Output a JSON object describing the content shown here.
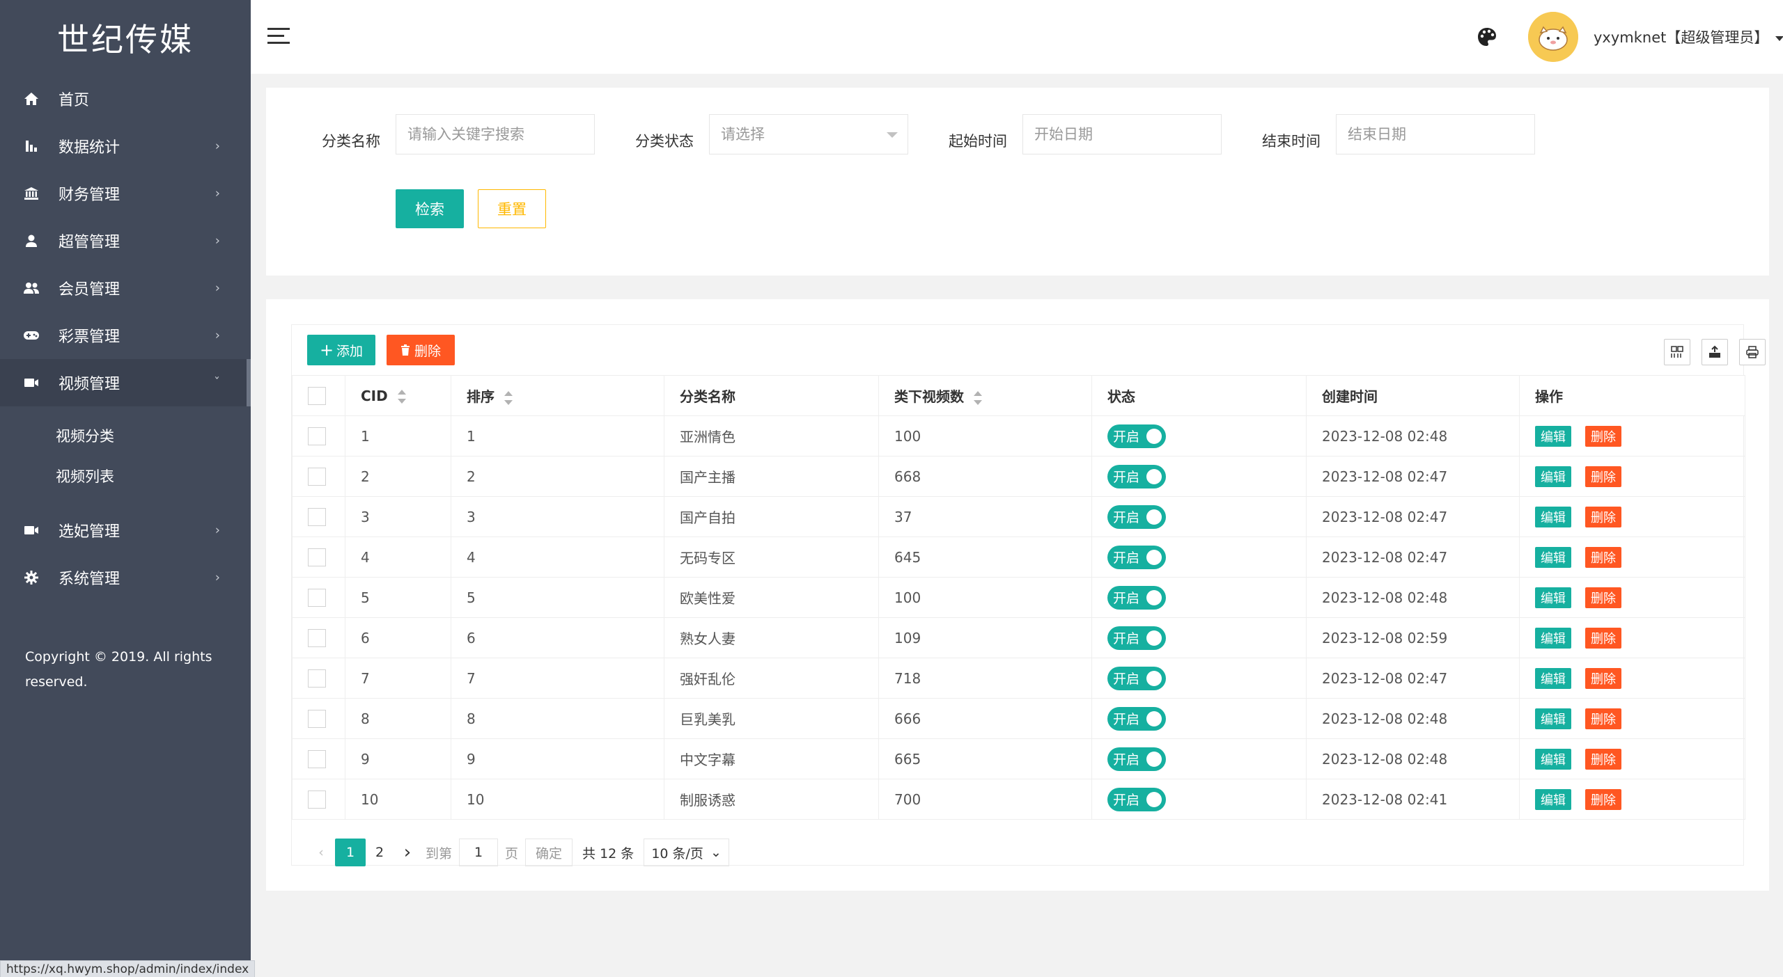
{
  "sidebar": {
    "logo": "世纪传媒",
    "items": [
      {
        "label": "首页",
        "icon": "home-icon"
      },
      {
        "label": "数据统计",
        "icon": "bar-chart-icon"
      },
      {
        "label": "财务管理",
        "icon": "bank-icon"
      },
      {
        "label": "超管管理",
        "icon": "user-icon"
      },
      {
        "label": "会员管理",
        "icon": "users-icon"
      },
      {
        "label": "彩票管理",
        "icon": "gamepad-icon"
      },
      {
        "label": "视频管理",
        "icon": "video-icon"
      },
      {
        "label": "选妃管理",
        "icon": "video-icon"
      },
      {
        "label": "系统管理",
        "icon": "gear-icon"
      }
    ],
    "video_sub": [
      "视频分类",
      "视频列表"
    ],
    "copyright": "Copyright © 2019. All rights reserved."
  },
  "header": {
    "username": "yxymknet【超级管理员】"
  },
  "search": {
    "name_label": "分类名称",
    "name_placeholder": "请输入关键字搜索",
    "status_label": "分类状态",
    "status_value": "请选择",
    "start_label": "起始时间",
    "start_placeholder": "开始日期",
    "end_label": "结束时间",
    "end_placeholder": "结束日期",
    "search_button": "检索",
    "reset_button": "重置"
  },
  "table": {
    "add_button": "添加",
    "delete_button": "删除",
    "columns": [
      "CID",
      "排序",
      "分类名称",
      "类下视频数",
      "状态",
      "创建时间",
      "操作"
    ],
    "switch_label": "开启",
    "edit_label": "编辑",
    "remove_label": "删除",
    "rows": [
      {
        "cid": "1",
        "sort": "1",
        "name": "亚洲情色",
        "count": "100",
        "created": "2023-12-08 02:48"
      },
      {
        "cid": "2",
        "sort": "2",
        "name": "国产主播",
        "count": "668",
        "created": "2023-12-08 02:47"
      },
      {
        "cid": "3",
        "sort": "3",
        "name": "国产自拍",
        "count": "37",
        "created": "2023-12-08 02:47"
      },
      {
        "cid": "4",
        "sort": "4",
        "name": "无码专区",
        "count": "645",
        "created": "2023-12-08 02:47"
      },
      {
        "cid": "5",
        "sort": "5",
        "name": "欧美性爱",
        "count": "100",
        "created": "2023-12-08 02:48"
      },
      {
        "cid": "6",
        "sort": "6",
        "name": "熟女人妻",
        "count": "109",
        "created": "2023-12-08 02:59"
      },
      {
        "cid": "7",
        "sort": "7",
        "name": "强奸乱伦",
        "count": "718",
        "created": "2023-12-08 02:47"
      },
      {
        "cid": "8",
        "sort": "8",
        "name": "巨乳美乳",
        "count": "666",
        "created": "2023-12-08 02:48"
      },
      {
        "cid": "9",
        "sort": "9",
        "name": "中文字幕",
        "count": "665",
        "created": "2023-12-08 02:48"
      },
      {
        "cid": "10",
        "sort": "10",
        "name": "制服诱惑",
        "count": "700",
        "created": "2023-12-08 02:41"
      }
    ]
  },
  "pagination": {
    "page1": "1",
    "page2": "2",
    "goto_label": "到第",
    "goto_value": "1",
    "page_unit": "页",
    "confirm": "确定",
    "total": "共 12 条",
    "per_page": "10 条/页"
  },
  "status_bar": "https://xq.hwym.shop/admin/index/index",
  "colors": {
    "sidebar": "#424a5a",
    "primary": "#16b0a0",
    "danger": "#ff5722",
    "warning": "#ffb800"
  }
}
